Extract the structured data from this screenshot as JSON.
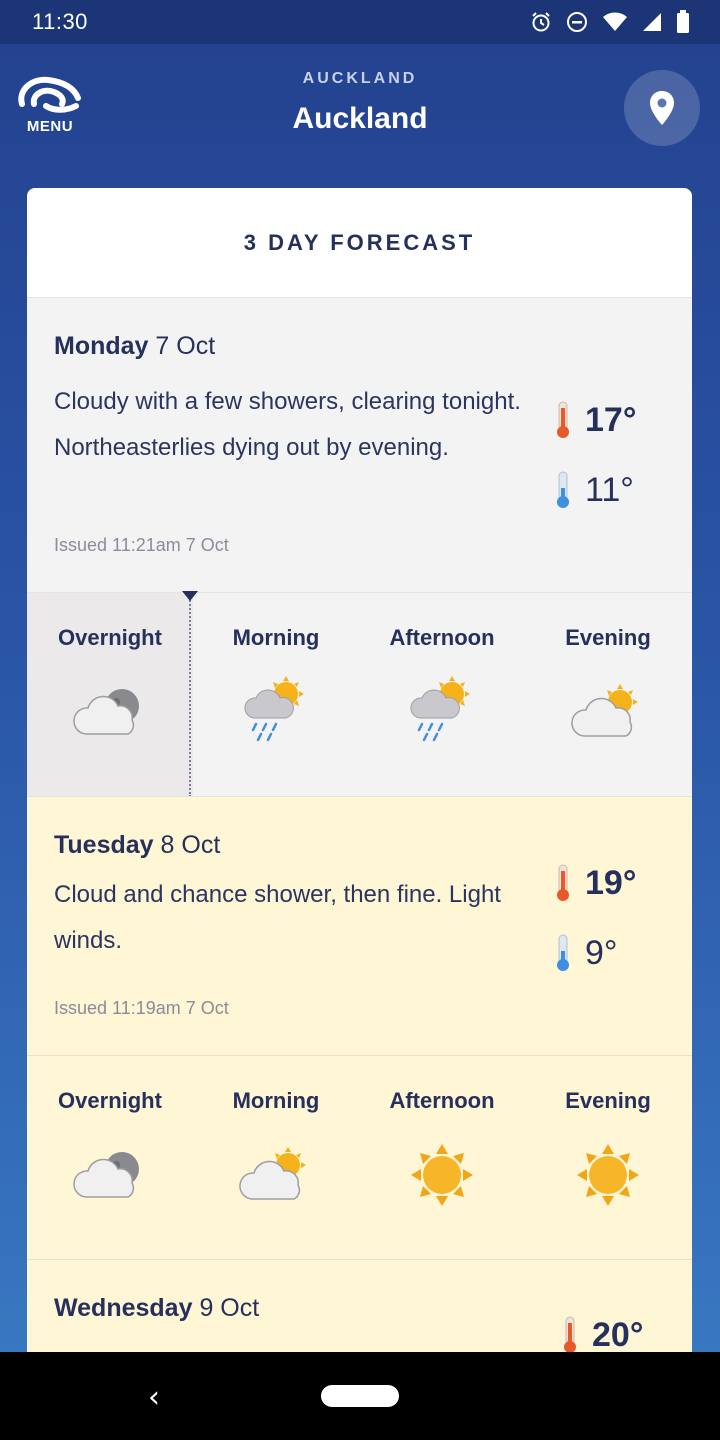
{
  "status_bar": {
    "time": "11:30",
    "icons": [
      "alarm-icon",
      "dnd-icon",
      "wifi-icon",
      "signal-icon",
      "battery-icon"
    ]
  },
  "header": {
    "menu_label": "MENU",
    "region": "AUCKLAND",
    "title": "Auckland"
  },
  "card": {
    "title": "3 DAY FORECAST"
  },
  "days": [
    {
      "day": "Monday",
      "date": "7 Oct",
      "description": "Cloudy with a few showers, clearing tonight. Northeasterlies dying out by evening.",
      "high": "17°",
      "low": "11°",
      "issued": "Issued 11:21am 7 Oct",
      "periods": [
        {
          "label": "Overnight",
          "icon": "cloud-moon-icon"
        },
        {
          "label": "Morning",
          "icon": "sun-cloud-rain-icon"
        },
        {
          "label": "Afternoon",
          "icon": "sun-cloud-rain-icon"
        },
        {
          "label": "Evening",
          "icon": "cloud-sun-icon"
        }
      ]
    },
    {
      "day": "Tuesday",
      "date": "8 Oct",
      "description": "Cloud and chance shower, then fine. Light winds.",
      "high": "19°",
      "low": "9°",
      "issued": "Issued 11:19am 7 Oct",
      "periods": [
        {
          "label": "Overnight",
          "icon": "cloud-moon-icon"
        },
        {
          "label": "Morning",
          "icon": "cloud-sun-icon"
        },
        {
          "label": "Afternoon",
          "icon": "sun-icon"
        },
        {
          "label": "Evening",
          "icon": "sun-icon"
        }
      ]
    },
    {
      "day": "Wednesday",
      "date": "9 Oct",
      "high": "20°"
    }
  ],
  "colors": {
    "header_bg": "#23418e",
    "text_navy": "#26305c",
    "cream": "#fff6d6",
    "grey": "#f4f3f4",
    "sun": "#f6b21a",
    "thermo_hot": "#e8592a",
    "thermo_cold": "#3d8fe0"
  }
}
